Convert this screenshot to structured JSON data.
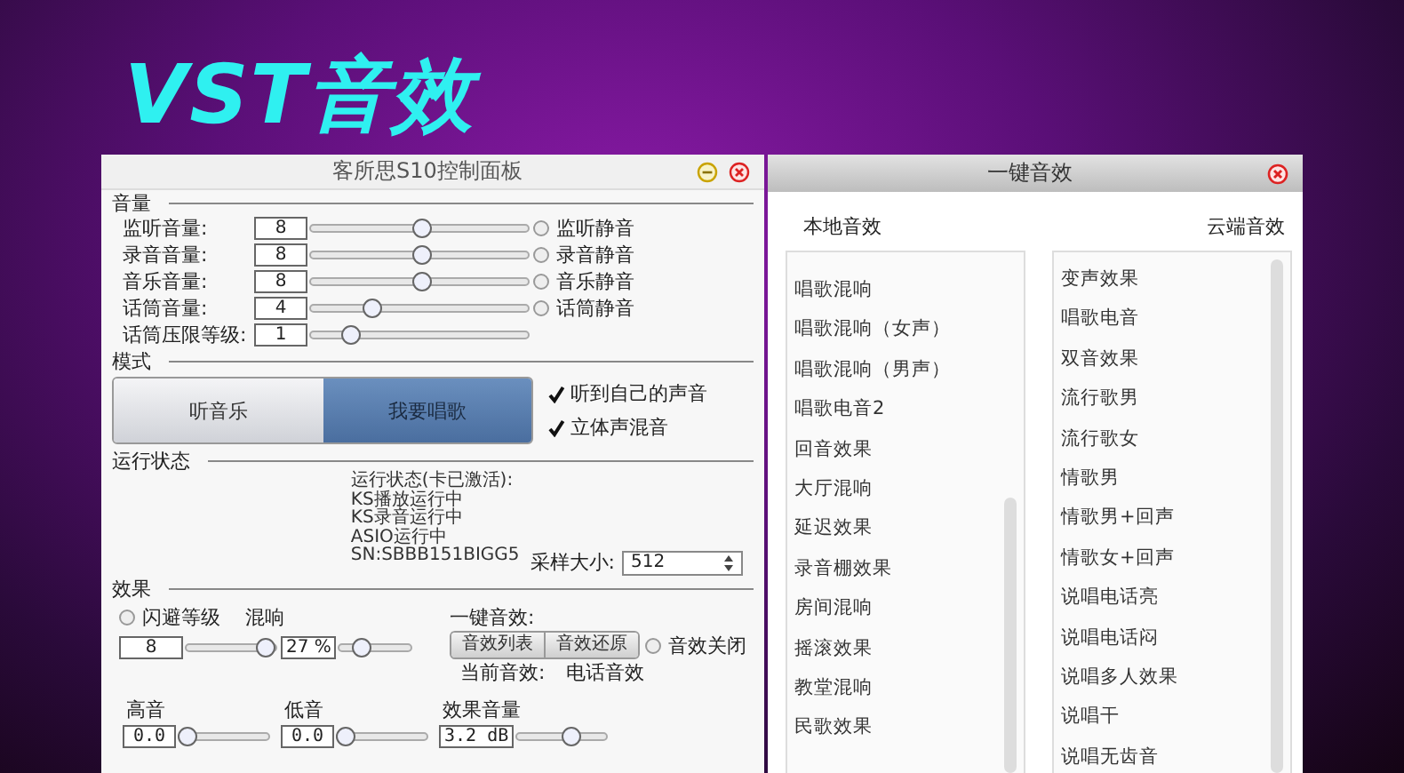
{
  "banner": {
    "title": "VST音效"
  },
  "control_panel": {
    "title": "客所思S10控制面板",
    "volume": {
      "heading": "音量",
      "rows": [
        {
          "label": "监听音量:",
          "value": "8",
          "level": 0.52,
          "mute": {
            "label": "监听静音",
            "selected": false
          }
        },
        {
          "label": "录音音量:",
          "value": "8",
          "level": 0.52,
          "mute": {
            "label": "录音静音",
            "selected": false
          }
        },
        {
          "label": "音乐音量:",
          "value": "8",
          "level": 0.52,
          "mute": {
            "label": "音乐静音",
            "selected": false
          }
        },
        {
          "label": "话筒音量:",
          "value": "4",
          "level": 0.27,
          "mute": {
            "label": "话筒静音",
            "selected": false
          }
        },
        {
          "label": "话筒压限等级:",
          "value": "1",
          "level": 0.16
        }
      ]
    },
    "mode": {
      "heading": "模式",
      "buttons": [
        {
          "label": "听音乐",
          "selected": false
        },
        {
          "label": "我要唱歌",
          "selected": true
        }
      ],
      "options": [
        {
          "label": "听到自己的声音",
          "checked": true
        },
        {
          "label": "立体声混音",
          "checked": true
        }
      ]
    },
    "status": {
      "heading": "运行状态",
      "lines": [
        "运行状态(卡已激活):",
        "KS播放运行中",
        "KS录音运行中",
        "ASIO运行中",
        "SN:SBBB151BIGG5"
      ],
      "sample_size": {
        "label": "采样大小:",
        "value": "512"
      }
    },
    "effects": {
      "heading": "效果",
      "duck": {
        "label": "闪避等级",
        "selected": false,
        "value": "8",
        "level": 1
      },
      "reverb": {
        "label": "混响",
        "value": "27 %",
        "level": 0.25
      },
      "one_key": {
        "label": "一键音效:",
        "buttons": [
          "音效列表",
          "音效还原"
        ],
        "off": {
          "label": "音效关闭",
          "selected": false
        },
        "current_label": "当前音效:",
        "current_value": "电话音效"
      },
      "eq": [
        {
          "label": "高音",
          "value": "0.0",
          "level": 0
        },
        {
          "label": "低音",
          "value": "0.0",
          "level": 0
        },
        {
          "label": "效果音量",
          "value": "3.2 dB",
          "level": 0.65
        }
      ]
    }
  },
  "effects_dialog": {
    "title": "一键音效",
    "local": {
      "heading": "本地音效",
      "items": [
        "唱歌混响",
        "唱歌混响（女声）",
        "唱歌混响（男声）",
        "唱歌电音2",
        "回音效果",
        "大厅混响",
        "延迟效果",
        "录音棚效果",
        "房间混响",
        "摇滚效果",
        "教堂混响",
        "民歌效果"
      ]
    },
    "cloud": {
      "heading": "云端音效",
      "items": [
        "变声效果",
        "唱歌电音",
        "双音效果",
        "流行歌男",
        "流行歌女",
        "情歌男",
        "情歌男+回声",
        "情歌女+回声",
        "说唱电话亮",
        "说唱电话闷",
        "说唱多人效果",
        "说唱干",
        "说唱无齿音"
      ]
    }
  }
}
